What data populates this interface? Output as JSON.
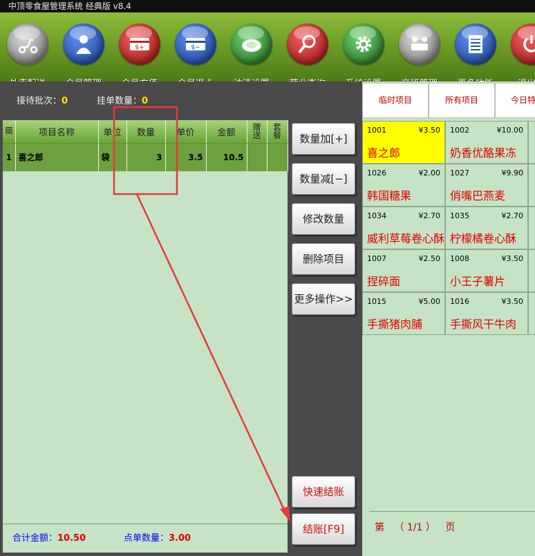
{
  "window": {
    "title": "中顶零食屋管理系统 经典版 v8.4"
  },
  "toolbar": [
    {
      "label": "外卖配送",
      "icon": "scooter-icon",
      "color": "#7a7a7a"
    },
    {
      "label": "会员管理",
      "icon": "member-icon",
      "color": "#1f4fb0"
    },
    {
      "label": "会员充值",
      "icon": "card-recharge-icon",
      "color": "#c81e1e"
    },
    {
      "label": "会员退卡",
      "icon": "card-return-icon",
      "color": "#1f4fb0"
    },
    {
      "label": "沽清设置",
      "icon": "plate-icon",
      "color": "#2f8a2f"
    },
    {
      "label": "营业查询",
      "icon": "search-icon",
      "color": "#c81e1e"
    },
    {
      "label": "系统设置",
      "icon": "gear-icon",
      "color": "#2f8a2f"
    },
    {
      "label": "交班管理",
      "icon": "handover-icon",
      "color": "#7a7a7a"
    },
    {
      "label": "更多功能",
      "icon": "list-icon",
      "color": "#1f4fb0"
    },
    {
      "label": "退出系",
      "icon": "power-icon",
      "color": "#c81e1e"
    }
  ],
  "info": {
    "reception_label": "接待批次：",
    "reception_value": "0",
    "pending_label": "挂单数量：",
    "pending_value": "0"
  },
  "order_table": {
    "columns": [
      "项目名称",
      "单位",
      "数量",
      "单价",
      "金额",
      "赠送",
      "套餐"
    ],
    "rows": [
      {
        "index": "1",
        "name": "喜之郎",
        "unit": "袋",
        "qty": "3",
        "price": "3.5",
        "amount": "10.5",
        "gift": "",
        "combo": ""
      }
    ]
  },
  "totals": {
    "amount_label": "合计金额：",
    "amount_value": "10.50",
    "count_label": "点单数量：",
    "count_value": "3.00"
  },
  "actions": {
    "qty_add": "数量加[+]",
    "qty_sub": "数量减[−]",
    "edit_qty": "修改数量",
    "delete_item": "删除项目",
    "more_ops": "更多操作>>",
    "quick_checkout": "快速结账",
    "checkout": "结账[F9]"
  },
  "category_tabs": [
    "临时项目",
    "所有项目",
    "今日特"
  ],
  "products": [
    {
      "code": "1001",
      "price": "¥3.50",
      "name": "喜之郎",
      "selected": true
    },
    {
      "code": "1002",
      "price": "¥10.00",
      "name": "奶香优酪果冻",
      "selected": false
    },
    {
      "code": "1026",
      "price": "¥2.00",
      "name": "韩国糖果",
      "selected": false
    },
    {
      "code": "1027",
      "price": "¥9.90",
      "name": "俏嘴巴燕麦",
      "selected": false
    },
    {
      "code": "1034",
      "price": "¥2.70",
      "name": "威利草莓卷心酥",
      "selected": false
    },
    {
      "code": "1035",
      "price": "¥2.70",
      "name": "柠檬橘卷心酥",
      "selected": false
    },
    {
      "code": "1007",
      "price": "¥2.50",
      "name": "捏碎面",
      "selected": false
    },
    {
      "code": "1008",
      "price": "¥3.50",
      "name": "小王子薯片",
      "selected": false
    },
    {
      "code": "1015",
      "price": "¥5.00",
      "name": "手撕猪肉脯",
      "selected": false
    },
    {
      "code": "1016",
      "price": "¥3.50",
      "name": "手撕风干牛肉",
      "selected": false
    }
  ],
  "pager": {
    "prefix": "第",
    "value": "（ 1/1 ）",
    "suffix": "页"
  },
  "colors": {
    "annotation": "#e8393b",
    "toolbar": "#6f9e28",
    "panel": "#c6e3c6"
  }
}
